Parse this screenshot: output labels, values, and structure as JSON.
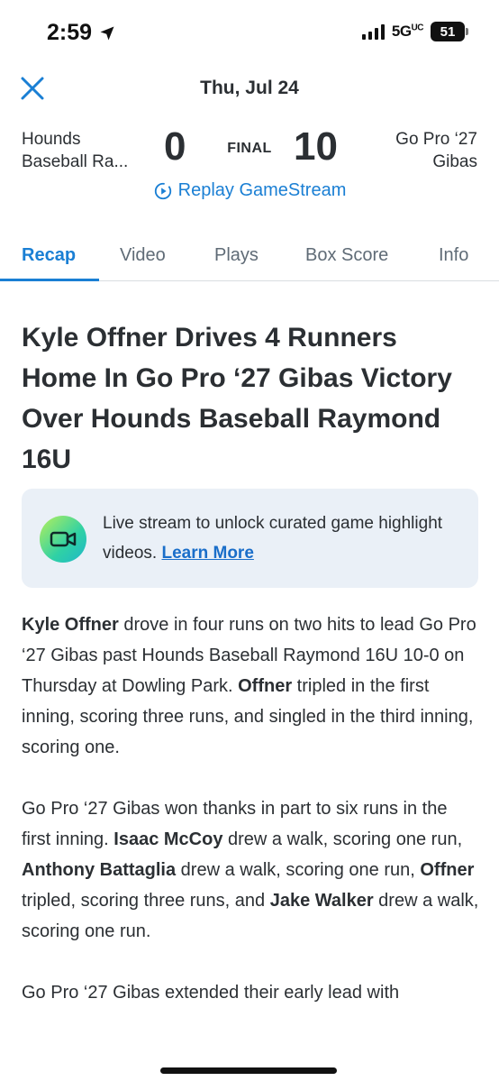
{
  "status": {
    "time": "2:59",
    "network": "5G",
    "network_suffix": "UC",
    "battery": "51"
  },
  "header": {
    "date": "Thu, Jul 24"
  },
  "scoreboard": {
    "home_team_line1": "Hounds",
    "home_team_line2": "Baseball Ra...",
    "home_score": "0",
    "status": "FINAL",
    "away_score": "10",
    "away_team_line1": "Go Pro ‘27",
    "away_team_line2": "Gibas"
  },
  "replay_label": "Replay GameStream",
  "tabs": [
    {
      "label": "Recap"
    },
    {
      "label": "Video"
    },
    {
      "label": "Plays"
    },
    {
      "label": "Box Score"
    },
    {
      "label": "Info"
    }
  ],
  "headline": "Kyle Offner Drives 4 Runners Home In Go Pro ‘27 Gibas Victory Over Hounds Baseball Raymond 16U",
  "promo": {
    "text": "Live stream to unlock curated game highlight videos.",
    "link": "Learn More"
  },
  "article": {
    "p1": {
      "b1": "Kyle Offner",
      "t1": " drove in four runs on two hits to lead Go Pro ‘27 Gibas past Hounds Baseball Raymond 16U 10-0 on Thursday at Dowling Park. ",
      "b2": "Offner",
      "t2": " tripled in the first inning, scoring three runs, and singled in the third inning, scoring one."
    },
    "p2": {
      "t1": "Go Pro ‘27 Gibas won thanks in part to six runs in the first inning.  ",
      "b1": "Isaac McCoy",
      "t2": " drew a walk, scoring one run, ",
      "b2": "Anthony Battaglia",
      "t3": " drew a walk, scoring one run, ",
      "b3": "Offner",
      "t4": " tripled, scoring three runs, and ",
      "b4": "Jake Walker",
      "t5": " drew a walk, scoring one run."
    },
    "p3": {
      "t1": "Go Pro ‘27 Gibas extended their early lead with"
    }
  },
  "colors": {
    "accent": "#1a7fd4",
    "text": "#2b2f33",
    "promo_bg": "#eaf0f7"
  }
}
